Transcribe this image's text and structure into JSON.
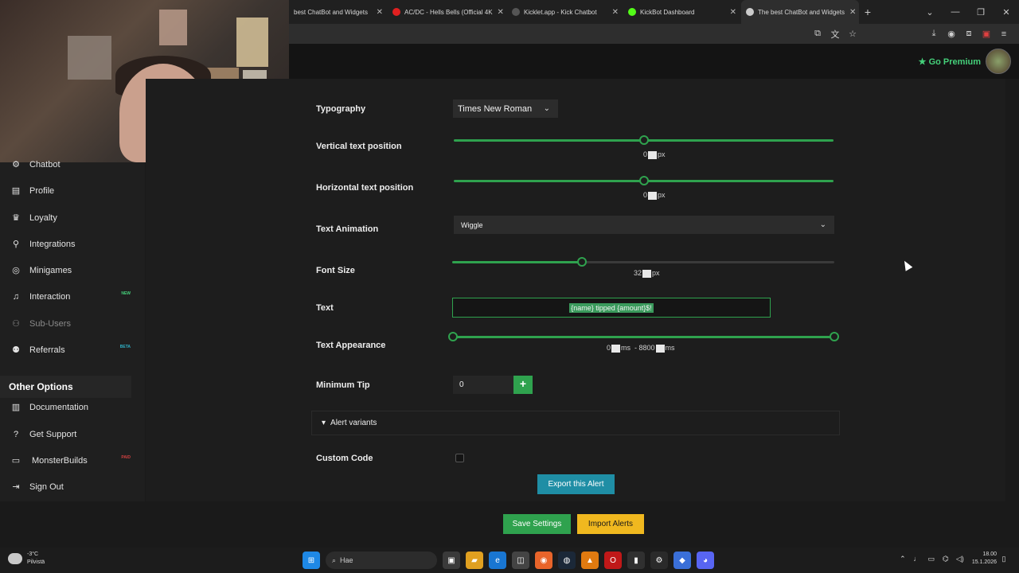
{
  "browser": {
    "tabs": [
      {
        "title": "best ChatBot and Widgets",
        "icon": "kickbot-icon",
        "color": "#3a7bd5"
      },
      {
        "title": "AC/DC - Hells Bells (Official 4K",
        "icon": "youtube-icon",
        "color": "#e02020"
      },
      {
        "title": "Kicklet.app - Kick Chatbot",
        "icon": "kicklet-icon",
        "color": "#555555"
      },
      {
        "title": "KickBot Dashboard",
        "icon": "kickbot-dashboard-icon",
        "color": "#53fc18"
      },
      {
        "title": "The best ChatBot and Widgets",
        "icon": "kickbot-icon",
        "color": "#cccccc"
      }
    ],
    "new_tab": "+",
    "window_controls": [
      "—",
      "❐",
      "✕"
    ]
  },
  "header": {
    "premium_label": "Go Premium"
  },
  "sidebar": {
    "items": [
      {
        "label": "Chatbot",
        "icon": "robot-icon"
      },
      {
        "label": "Profile",
        "icon": "id-card-icon"
      },
      {
        "label": "Loyalty",
        "icon": "trophy-icon"
      },
      {
        "label": "Integrations",
        "icon": "plug-icon"
      },
      {
        "label": "Minigames",
        "icon": "gamepad-icon"
      },
      {
        "label": "Interaction",
        "icon": "music-note-icon",
        "badge": "NEW",
        "badge_color": "#45d07a"
      },
      {
        "label": "Sub-Users",
        "icon": "users-icon",
        "muted": true
      },
      {
        "label": "Referrals",
        "icon": "people-icon",
        "badge": "BETA",
        "badge_color": "#2fb3c9"
      }
    ],
    "other_options_title": "Other Options",
    "other_items": [
      {
        "label": "Documentation",
        "icon": "book-icon"
      },
      {
        "label": "Get Support",
        "icon": "question-icon"
      },
      {
        "label": "MonsterBuilds",
        "icon": "monitor-icon",
        "badge": "PAID",
        "badge_color": "#d04040"
      },
      {
        "label": "Sign Out",
        "icon": "sign-out-icon"
      }
    ]
  },
  "form": {
    "typography": {
      "label": "Typography",
      "value": "Times New Roman"
    },
    "vertical_position": {
      "label": "Vertical text position",
      "value": "0",
      "unit": "px",
      "fraction": 0.5
    },
    "horizontal_position": {
      "label": "Horizontal text position",
      "value": "0",
      "unit": "px",
      "fraction": 0.5
    },
    "text_animation": {
      "label": "Text Animation",
      "value": "Wiggle"
    },
    "font_size": {
      "label": "Font Size",
      "value": "32",
      "unit": "px",
      "fraction": 0.34
    },
    "text": {
      "label": "Text",
      "value": "{name} tipped {amount}$!"
    },
    "text_appearance": {
      "label": "Text Appearance",
      "start": "0",
      "end": "8800",
      "unit": "ms"
    },
    "minimum_tip": {
      "label": "Minimum Tip",
      "value": "0",
      "step_up": "+",
      "step_down": "−"
    },
    "alert_variants": {
      "label": "Alert variants"
    },
    "custom_code": {
      "label": "Custom Code",
      "checked": false
    },
    "export_label": "Export this Alert",
    "save_label": "Save Settings",
    "import_label": "Import Alerts"
  },
  "taskbar": {
    "weather_temp": "-3°C",
    "weather_desc": "Pilvistä",
    "search_placeholder": "Hae",
    "time": "18.00",
    "date": "15.1.2026"
  },
  "colors": {
    "accent_green": "#2fa24e",
    "premium_green": "#45d07a",
    "export_teal": "#1f8ea5",
    "import_yellow": "#f0b81f"
  }
}
